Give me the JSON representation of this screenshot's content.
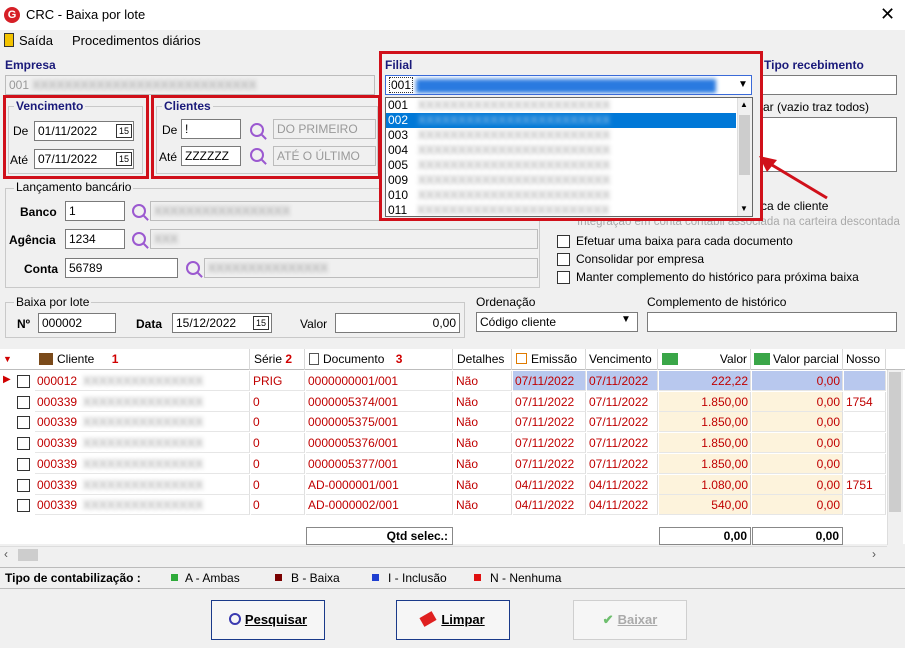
{
  "window": {
    "title": "CRC - Baixa por lote",
    "close": "✕"
  },
  "menu": {
    "exit": "Saída",
    "daily": "Procedimentos diários"
  },
  "empresa": {
    "label": "Empresa",
    "value": "001"
  },
  "filial": {
    "label": "Filial",
    "value": "001",
    "options": [
      "001",
      "002",
      "003",
      "004",
      "005",
      "009",
      "010",
      "011"
    ],
    "selected": "002"
  },
  "tipo_recebimento": {
    "label": "Tipo recebimento",
    "hint": "ar (vazio traz todos)"
  },
  "vencimento": {
    "label": "Vencimento",
    "de_label": "De",
    "ate_label": "Até",
    "de": "01/11/2022",
    "ate": "07/11/2022"
  },
  "clientes": {
    "label": "Clientes",
    "de_label": "De",
    "ate_label": "Até",
    "de": "!",
    "ate": "ZZZZZZ",
    "de_desc": "DO PRIMEIRO",
    "ate_desc": "ATÉ O ÚLTIMO"
  },
  "lancamento": {
    "label": "Lançamento bancário",
    "banco_label": "Banco",
    "banco": "1",
    "agencia_label": "Agência",
    "agencia": "1234",
    "conta_label": "Conta",
    "conta": "56789"
  },
  "options": {
    "opt1": "ca de cliente",
    "opt2": "Integração em conta contábil associada na carteira descontada",
    "opt3": "Efetuar uma baixa para cada documento",
    "opt4": "Consolidar por empresa",
    "opt5": "Manter complemento do histórico para próxima baixa"
  },
  "baixa_lote": {
    "label": "Baixa por lote",
    "n_label": "Nº",
    "n": "000002",
    "data_label": "Data",
    "data": "15/12/2022",
    "valor_label": "Valor",
    "valor": "0,00"
  },
  "ordenacao": {
    "label": "Ordenação",
    "value": "Código cliente"
  },
  "complemento": {
    "label": "Complemento de histórico",
    "value": ""
  },
  "grid": {
    "headers": {
      "cliente": "Cliente",
      "cliente_n": "1",
      "serie": "Série",
      "serie_n": "2",
      "documento": "Documento",
      "documento_n": "3",
      "detalhes": "Detalhes",
      "emissao": "Emissão",
      "vencimento": "Vencimento",
      "valor": "Valor",
      "valor_parcial": "Valor parcial",
      "nosso": "Nosso"
    },
    "rows": [
      {
        "cliente": "000012",
        "serie": "PRIG",
        "documento": "0000000001/001",
        "detalhes": "Não",
        "emissao": "07/11/2022",
        "vencimento": "07/11/2022",
        "valor": "222,22",
        "valor_parcial": "0,00",
        "nosso": ""
      },
      {
        "cliente": "000339",
        "serie": "0",
        "documento": "0000005374/001",
        "detalhes": "Não",
        "emissao": "07/11/2022",
        "vencimento": "07/11/2022",
        "valor": "1.850,00",
        "valor_parcial": "0,00",
        "nosso": "1754"
      },
      {
        "cliente": "000339",
        "serie": "0",
        "documento": "0000005375/001",
        "detalhes": "Não",
        "emissao": "07/11/2022",
        "vencimento": "07/11/2022",
        "valor": "1.850,00",
        "valor_parcial": "0,00",
        "nosso": ""
      },
      {
        "cliente": "000339",
        "serie": "0",
        "documento": "0000005376/001",
        "detalhes": "Não",
        "emissao": "07/11/2022",
        "vencimento": "07/11/2022",
        "valor": "1.850,00",
        "valor_parcial": "0,00",
        "nosso": ""
      },
      {
        "cliente": "000339",
        "serie": "0",
        "documento": "0000005377/001",
        "detalhes": "Não",
        "emissao": "07/11/2022",
        "vencimento": "07/11/2022",
        "valor": "1.850,00",
        "valor_parcial": "0,00",
        "nosso": ""
      },
      {
        "cliente": "000339",
        "serie": "0",
        "documento": "AD-0000001/001",
        "detalhes": "Não",
        "emissao": "04/11/2022",
        "vencimento": "04/11/2022",
        "valor": "1.080,00",
        "valor_parcial": "0,00",
        "nosso": "1751"
      },
      {
        "cliente": "000339",
        "serie": "0",
        "documento": "AD-0000002/001",
        "detalhes": "Não",
        "emissao": "04/11/2022",
        "vencimento": "04/11/2022",
        "valor": "540,00",
        "valor_parcial": "0,00",
        "nosso": ""
      }
    ],
    "footer": {
      "qtd_label": "Qtd selec.:",
      "total_valor": "0,00",
      "total_parcial": "0,00"
    }
  },
  "legend": {
    "label": "Tipo de contabilização :",
    "a": "A - Ambas",
    "b": "B - Baixa",
    "i": "I - Inclusão",
    "n": "N - Nenhuma",
    "colors": {
      "a": "#2eaa3a",
      "b": "#7a0000",
      "i": "#1f3fd0",
      "n": "#e01010"
    }
  },
  "buttons": {
    "pesquisar": "Pesquisar",
    "limpar": "Limpar",
    "baixar": "Baixar"
  }
}
